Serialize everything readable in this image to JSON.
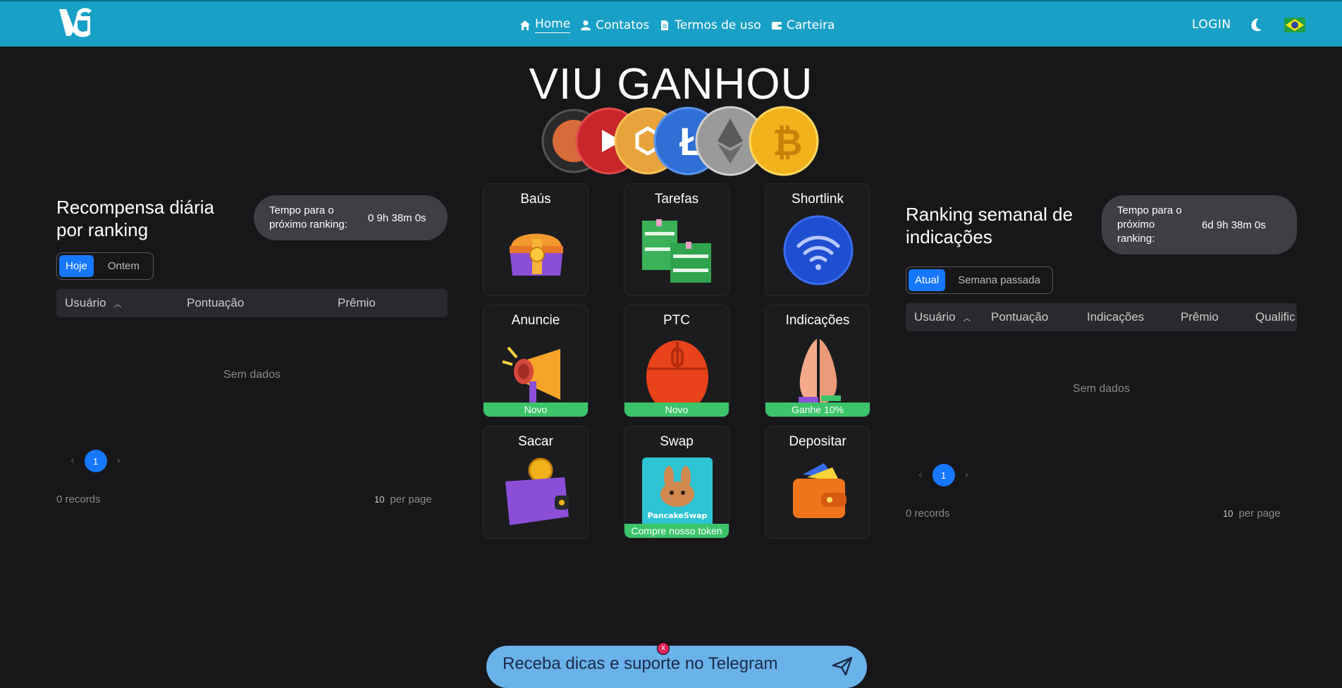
{
  "nav": {
    "items": [
      {
        "label": "Home",
        "icon": "home-icon"
      },
      {
        "label": "Contatos",
        "icon": "user-icon"
      },
      {
        "label": "Termos de uso",
        "icon": "document-icon"
      },
      {
        "label": "Carteira",
        "icon": "wallet-icon"
      }
    ],
    "login": "LOGIN"
  },
  "hero": {
    "title": "VIU GANHOU"
  },
  "daily": {
    "title": "Recompensa diária por ranking",
    "timer_label": "Tempo para o próximo ranking:",
    "timer_value": "0  9h  38m  0s",
    "tabs": [
      "Hoje",
      "Ontem"
    ],
    "columns": [
      "Usuário",
      "Pontuação",
      "Prêmio"
    ],
    "no_data": "Sem dados",
    "page": "1",
    "records": "0 records",
    "per_page_num": "10",
    "per_page_label": "per page"
  },
  "weekly": {
    "title": "Ranking semanal de indicações",
    "timer_label": "Tempo para o próximo ranking:",
    "timer_value": "6d  9h  38m  0s",
    "tabs": [
      "Atual",
      "Semana passada"
    ],
    "columns": [
      "Usuário",
      "Pontuação",
      "Indicações",
      "Prêmio",
      "Qualific"
    ],
    "no_data": "Sem dados",
    "page": "1",
    "records": "0 records",
    "per_page_num": "10",
    "per_page_label": "per page"
  },
  "cards": [
    {
      "title": "Baús",
      "icon": "treasure-chest-icon",
      "tag": ""
    },
    {
      "title": "Tarefas",
      "icon": "money-stack-icon",
      "tag": ""
    },
    {
      "title": "Shortlink",
      "icon": "wifi-icon",
      "tag": ""
    },
    {
      "title": "Anuncie",
      "icon": "megaphone-icon",
      "tag": "Novo"
    },
    {
      "title": "PTC",
      "icon": "mouse-icon",
      "tag": "Novo"
    },
    {
      "title": "Indicações",
      "icon": "praying-hands-icon",
      "tag": "Ganhe 10%"
    },
    {
      "title": "Sacar",
      "icon": "wallet-coin-icon",
      "tag": ""
    },
    {
      "title": "Swap",
      "icon": "pancakeswap-icon",
      "tag": "Compre nosso token",
      "brand": "PancakeSwap"
    },
    {
      "title": "Depositar",
      "icon": "deposit-wallet-icon",
      "tag": ""
    }
  ],
  "telegram": {
    "text": "Receba dicas e suporte no Telegram",
    "close": "x"
  },
  "colors": {
    "header": "#19a0c6",
    "accent": "#1677ff",
    "tag": "#3cc46a",
    "background": "#17171a"
  }
}
